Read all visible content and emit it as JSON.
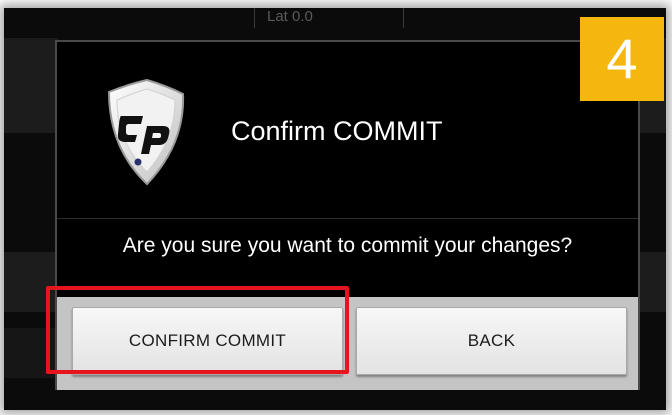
{
  "background": {
    "readout": "Lat 0.0"
  },
  "dialog": {
    "title": "Confirm COMMIT",
    "message": "Are you sure you want to commit your changes?",
    "logo_icon": "cp-shield-logo",
    "buttons": {
      "confirm_label": "CONFIRM COMMIT",
      "back_label": "BACK"
    }
  },
  "annotation": {
    "step_number": "4",
    "badge_color": "#f5b70e",
    "highlight_color": "#e8141c"
  }
}
